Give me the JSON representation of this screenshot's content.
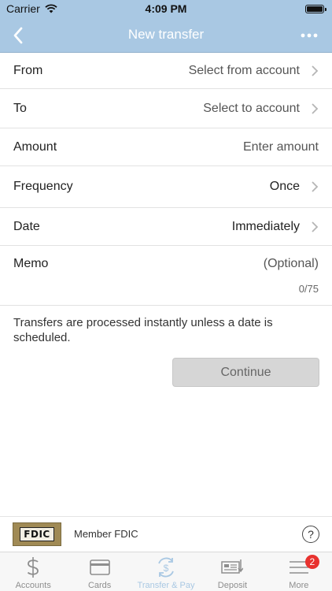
{
  "status_bar": {
    "carrier": "Carrier",
    "time": "4:09 PM"
  },
  "nav": {
    "title": "New transfer",
    "back_icon": "chevron-left-icon",
    "more_icon": "more-horizontal-icon"
  },
  "form": {
    "from": {
      "label": "From",
      "value": "Select from account"
    },
    "to": {
      "label": "To",
      "value": "Select to account"
    },
    "amount": {
      "label": "Amount",
      "placeholder": "Enter amount"
    },
    "frequency": {
      "label": "Frequency",
      "value": "Once"
    },
    "date": {
      "label": "Date",
      "value": "Immediately"
    },
    "memo": {
      "label": "Memo",
      "placeholder": "(Optional)",
      "count": "0/75"
    }
  },
  "info_text": "Transfers are processed instantly unless a date is scheduled.",
  "continue_label": "Continue",
  "footer": {
    "fdic_logo_text": "FDIC",
    "member_text": "Member FDIC",
    "help_symbol": "?"
  },
  "tabs": [
    {
      "label": "Accounts",
      "icon": "dollar-icon"
    },
    {
      "label": "Cards",
      "icon": "card-icon"
    },
    {
      "label": "Transfer & Pay",
      "icon": "transfer-pay-icon",
      "active": true
    },
    {
      "label": "Deposit",
      "icon": "deposit-check-icon"
    },
    {
      "label": "More",
      "icon": "menu-icon",
      "badge": "2"
    }
  ],
  "colors": {
    "header": "#a9c8e3",
    "badge": "#e8322f",
    "button_disabled": "#d6d6d6"
  }
}
